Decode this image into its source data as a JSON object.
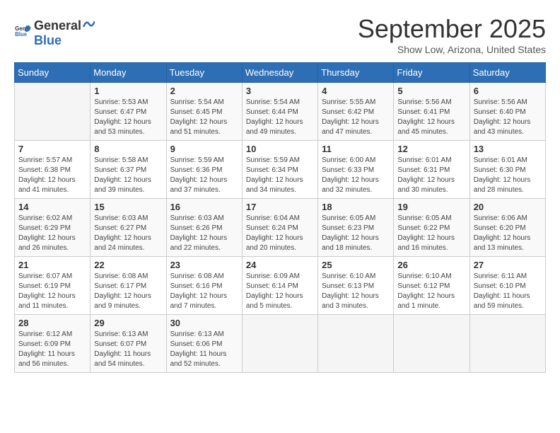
{
  "header": {
    "logo_general": "General",
    "logo_blue": "Blue",
    "month_title": "September 2025",
    "location": "Show Low, Arizona, United States"
  },
  "days_of_week": [
    "Sunday",
    "Monday",
    "Tuesday",
    "Wednesday",
    "Thursday",
    "Friday",
    "Saturday"
  ],
  "weeks": [
    [
      {
        "day": "",
        "info": ""
      },
      {
        "day": "1",
        "info": "Sunrise: 5:53 AM\nSunset: 6:47 PM\nDaylight: 12 hours\nand 53 minutes."
      },
      {
        "day": "2",
        "info": "Sunrise: 5:54 AM\nSunset: 6:45 PM\nDaylight: 12 hours\nand 51 minutes."
      },
      {
        "day": "3",
        "info": "Sunrise: 5:54 AM\nSunset: 6:44 PM\nDaylight: 12 hours\nand 49 minutes."
      },
      {
        "day": "4",
        "info": "Sunrise: 5:55 AM\nSunset: 6:42 PM\nDaylight: 12 hours\nand 47 minutes."
      },
      {
        "day": "5",
        "info": "Sunrise: 5:56 AM\nSunset: 6:41 PM\nDaylight: 12 hours\nand 45 minutes."
      },
      {
        "day": "6",
        "info": "Sunrise: 5:56 AM\nSunset: 6:40 PM\nDaylight: 12 hours\nand 43 minutes."
      }
    ],
    [
      {
        "day": "7",
        "info": "Sunrise: 5:57 AM\nSunset: 6:38 PM\nDaylight: 12 hours\nand 41 minutes."
      },
      {
        "day": "8",
        "info": "Sunrise: 5:58 AM\nSunset: 6:37 PM\nDaylight: 12 hours\nand 39 minutes."
      },
      {
        "day": "9",
        "info": "Sunrise: 5:59 AM\nSunset: 6:36 PM\nDaylight: 12 hours\nand 37 minutes."
      },
      {
        "day": "10",
        "info": "Sunrise: 5:59 AM\nSunset: 6:34 PM\nDaylight: 12 hours\nand 34 minutes."
      },
      {
        "day": "11",
        "info": "Sunrise: 6:00 AM\nSunset: 6:33 PM\nDaylight: 12 hours\nand 32 minutes."
      },
      {
        "day": "12",
        "info": "Sunrise: 6:01 AM\nSunset: 6:31 PM\nDaylight: 12 hours\nand 30 minutes."
      },
      {
        "day": "13",
        "info": "Sunrise: 6:01 AM\nSunset: 6:30 PM\nDaylight: 12 hours\nand 28 minutes."
      }
    ],
    [
      {
        "day": "14",
        "info": "Sunrise: 6:02 AM\nSunset: 6:29 PM\nDaylight: 12 hours\nand 26 minutes."
      },
      {
        "day": "15",
        "info": "Sunrise: 6:03 AM\nSunset: 6:27 PM\nDaylight: 12 hours\nand 24 minutes."
      },
      {
        "day": "16",
        "info": "Sunrise: 6:03 AM\nSunset: 6:26 PM\nDaylight: 12 hours\nand 22 minutes."
      },
      {
        "day": "17",
        "info": "Sunrise: 6:04 AM\nSunset: 6:24 PM\nDaylight: 12 hours\nand 20 minutes."
      },
      {
        "day": "18",
        "info": "Sunrise: 6:05 AM\nSunset: 6:23 PM\nDaylight: 12 hours\nand 18 minutes."
      },
      {
        "day": "19",
        "info": "Sunrise: 6:05 AM\nSunset: 6:22 PM\nDaylight: 12 hours\nand 16 minutes."
      },
      {
        "day": "20",
        "info": "Sunrise: 6:06 AM\nSunset: 6:20 PM\nDaylight: 12 hours\nand 13 minutes."
      }
    ],
    [
      {
        "day": "21",
        "info": "Sunrise: 6:07 AM\nSunset: 6:19 PM\nDaylight: 12 hours\nand 11 minutes."
      },
      {
        "day": "22",
        "info": "Sunrise: 6:08 AM\nSunset: 6:17 PM\nDaylight: 12 hours\nand 9 minutes."
      },
      {
        "day": "23",
        "info": "Sunrise: 6:08 AM\nSunset: 6:16 PM\nDaylight: 12 hours\nand 7 minutes."
      },
      {
        "day": "24",
        "info": "Sunrise: 6:09 AM\nSunset: 6:14 PM\nDaylight: 12 hours\nand 5 minutes."
      },
      {
        "day": "25",
        "info": "Sunrise: 6:10 AM\nSunset: 6:13 PM\nDaylight: 12 hours\nand 3 minutes."
      },
      {
        "day": "26",
        "info": "Sunrise: 6:10 AM\nSunset: 6:12 PM\nDaylight: 12 hours\nand 1 minute."
      },
      {
        "day": "27",
        "info": "Sunrise: 6:11 AM\nSunset: 6:10 PM\nDaylight: 11 hours\nand 59 minutes."
      }
    ],
    [
      {
        "day": "28",
        "info": "Sunrise: 6:12 AM\nSunset: 6:09 PM\nDaylight: 11 hours\nand 56 minutes."
      },
      {
        "day": "29",
        "info": "Sunrise: 6:13 AM\nSunset: 6:07 PM\nDaylight: 11 hours\nand 54 minutes."
      },
      {
        "day": "30",
        "info": "Sunrise: 6:13 AM\nSunset: 6:06 PM\nDaylight: 11 hours\nand 52 minutes."
      },
      {
        "day": "",
        "info": ""
      },
      {
        "day": "",
        "info": ""
      },
      {
        "day": "",
        "info": ""
      },
      {
        "day": "",
        "info": ""
      }
    ]
  ]
}
